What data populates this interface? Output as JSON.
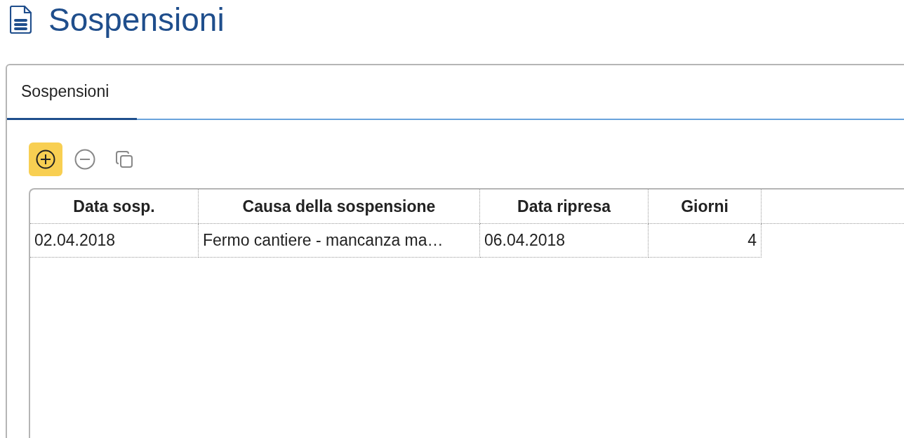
{
  "page": {
    "title": "Sospensioni"
  },
  "tabs": [
    {
      "label": "Sospensioni",
      "selected": true
    }
  ],
  "toolbar": [
    {
      "kind": "add",
      "highlighted": true
    },
    {
      "kind": "remove",
      "highlighted": false
    },
    {
      "kind": "copy",
      "highlighted": false
    }
  ],
  "table": {
    "columns": [
      {
        "label": "Data sosp.",
        "kind": "text"
      },
      {
        "label": "Causa della sospensione",
        "kind": "text"
      },
      {
        "label": "Data ripresa",
        "kind": "text"
      },
      {
        "label": "Giorni",
        "kind": "number"
      }
    ],
    "rows": [
      [
        "02.04.2018",
        "Fermo cantiere - mancanza ma…",
        "06.04.2018",
        "4"
      ]
    ]
  }
}
